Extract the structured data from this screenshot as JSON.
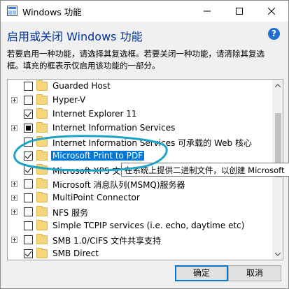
{
  "window": {
    "title": "Windows 功能",
    "app_icon": "windows-features-icon"
  },
  "header": {
    "heading": "启用或关闭 Windows 功能",
    "help_label": "?",
    "description": "若要启用一种功能，请选择其复选框。若要关闭一种功能，请清除其复选框。填充的框表示仅启用该功能的一部分。"
  },
  "features": [
    {
      "label": "Guarded Host",
      "state": "unchecked",
      "expandable": false
    },
    {
      "label": "Hyper-V",
      "state": "unchecked",
      "expandable": true
    },
    {
      "label": "Internet Explorer 11",
      "state": "checked",
      "expandable": false
    },
    {
      "label": "Internet Information Services",
      "state": "partial",
      "expandable": true
    },
    {
      "label": "Internet Information Services 可承载的 Web 核心",
      "state": "unchecked",
      "expandable": false
    },
    {
      "label": "Microsoft Print to PDF",
      "state": "checked",
      "expandable": false,
      "selected": true
    },
    {
      "label": "Microsoft XPS 文档写入程序",
      "state": "checked",
      "expandable": false
    },
    {
      "label": "Microsoft 消息队列(MSMQ)服务器",
      "state": "unchecked",
      "expandable": true
    },
    {
      "label": "MultiPoint Connector",
      "state": "unchecked",
      "expandable": true
    },
    {
      "label": "NFS 服务",
      "state": "unchecked",
      "expandable": true
    },
    {
      "label": "Simple TCPIP services (i.e. echo, daytime etc)",
      "state": "unchecked",
      "expandable": false
    },
    {
      "label": "SMB 1.0/CIFS 文件共享支持",
      "state": "unchecked",
      "expandable": true
    },
    {
      "label": "SMB Direct",
      "state": "checked",
      "expandable": false
    }
  ],
  "tooltip": {
    "text": "在系统上提供二进制文件，以创建 Microsoft"
  },
  "buttons": {
    "ok_label": "确定",
    "cancel_label": "取消"
  },
  "colors": {
    "heading": "#003399",
    "selection": "#0078d7",
    "annotation": "#1fa3c7"
  }
}
